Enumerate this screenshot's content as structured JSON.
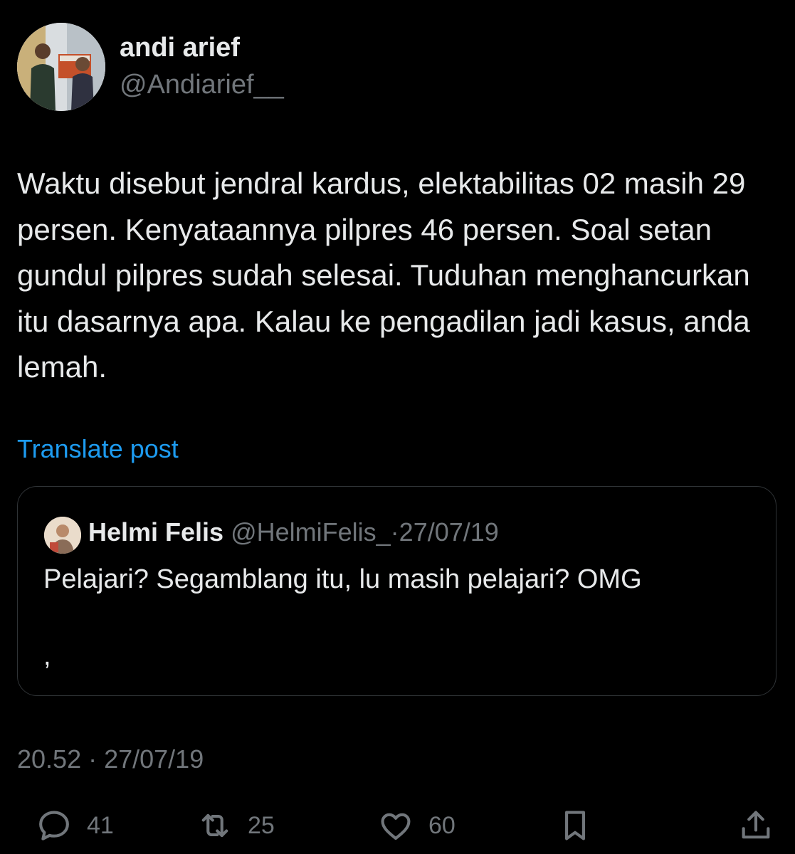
{
  "post": {
    "author": {
      "display_name": "andi arief",
      "handle": "@Andiarief__"
    },
    "text": "Waktu disebut jendral kardus, elektabilitas 02 masih 29 persen. Kenyataannya pilpres 46 persen. Soal setan gundul pilpres sudah selesai. Tuduhan menghancurkan itu dasarnya apa. Kalau ke pengadilan jadi kasus, anda lemah.",
    "translate_label": "Translate post",
    "timestamp": "20.52 · 27/07/19"
  },
  "quoted_post": {
    "display_name": "Helmi Felis",
    "handle": "@HelmiFelis_",
    "separator": "·",
    "date": "27/07/19",
    "text": "Pelajari? Segamblang itu, lu masih pelajari? OMG",
    "extra_line": ","
  },
  "actions": {
    "replies": "41",
    "reposts": "25",
    "likes": "60"
  },
  "colors": {
    "background": "#000000",
    "primary_text": "#e7e9ea",
    "secondary_text": "#71767b",
    "link": "#1d9bf0",
    "border": "#2f3336"
  },
  "icons": {
    "reply": "speech-bubble-icon",
    "repost": "repost-arrows-icon",
    "like": "heart-icon",
    "bookmark": "bookmark-icon",
    "share": "share-upload-icon"
  }
}
